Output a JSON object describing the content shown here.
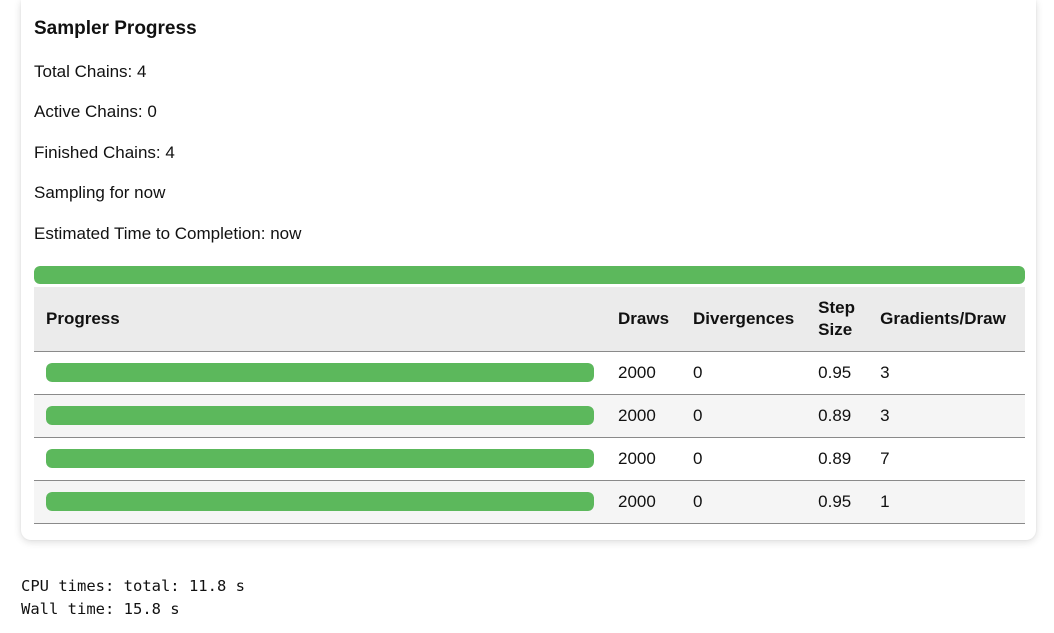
{
  "sampler": {
    "title": "Sampler Progress",
    "total_chains": "Total Chains: 4",
    "active_chains": "Active Chains: 0",
    "finished_chains": "Finished Chains: 4",
    "sampling_for": "Sampling for now",
    "eta": "Estimated Time to Completion: now",
    "overall_progress": 1.0
  },
  "colors": {
    "progress_fill": "#5cb85c",
    "progress_track": "#e5e5e5",
    "header_bg": "#ebebeb",
    "stripe_bg": "#f5f5f5"
  },
  "table": {
    "headers": {
      "progress": "Progress",
      "draws": "Draws",
      "divergences": "Divergences",
      "step_size": "Step Size",
      "gradients_per_draw": "Gradients/Draw"
    },
    "rows": [
      {
        "progress": 1.0,
        "draws": "2000",
        "divergences": "0",
        "step_size": "0.95",
        "gradients_per_draw": "3"
      },
      {
        "progress": 1.0,
        "draws": "2000",
        "divergences": "0",
        "step_size": "0.89",
        "gradients_per_draw": "3"
      },
      {
        "progress": 1.0,
        "draws": "2000",
        "divergences": "0",
        "step_size": "0.89",
        "gradients_per_draw": "7"
      },
      {
        "progress": 1.0,
        "draws": "2000",
        "divergences": "0",
        "step_size": "0.95",
        "gradients_per_draw": "1"
      }
    ]
  },
  "output": {
    "cpu_times": "CPU times: total: 11.8 s",
    "wall_time": "Wall time: 15.8 s"
  }
}
